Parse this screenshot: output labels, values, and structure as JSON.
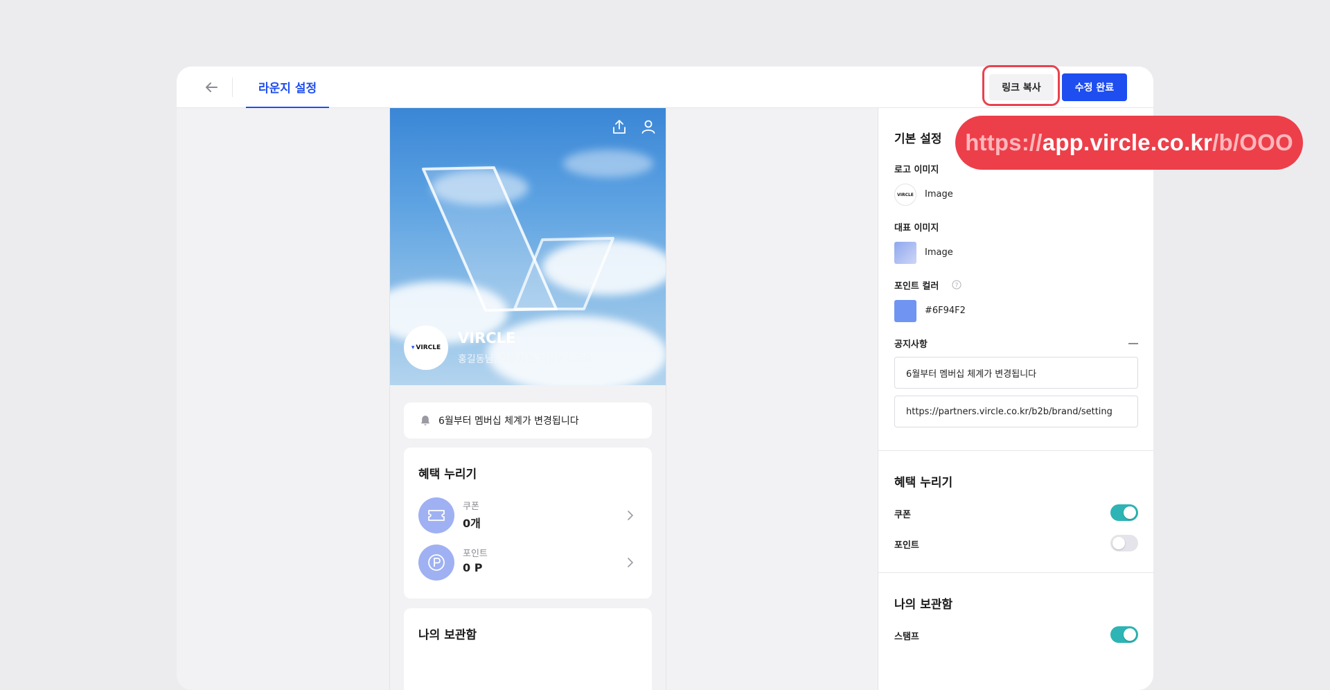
{
  "header": {
    "tab_label": "라운지 설정",
    "copy_link_label": "링크 복사",
    "done_label": "수정 완료"
  },
  "url_callout": {
    "protocol": "https://",
    "host": "app.vircle.co.kr",
    "path_prefix": "/b/",
    "slug": "OOO"
  },
  "preview": {
    "brand_name": "VIRCLE",
    "logo_text": "VIRCLE",
    "greeting": "홍길동님, 라운지는 처음이시군요",
    "notice_text": "6월부터 멤버십 체계가 변경됩니다",
    "benefits": {
      "title": "혜택 누리기",
      "coupon_label": "쿠폰",
      "coupon_value": "0개",
      "point_label": "포인트",
      "point_value": "0 P"
    },
    "vault_title": "나의 보관함"
  },
  "settings": {
    "basic_title": "기본 설정",
    "logo_image_label": "로고 이미지",
    "logo_image_value": "Image",
    "logo_thumb_text": "VIRCLE",
    "cover_image_label": "대표 이미지",
    "cover_image_value": "Image",
    "point_color_label": "포인트 컬러",
    "point_color_value": "#6F94F2",
    "notice_label": "공지사항",
    "notice_text": "6월부터 멤버십 체계가 변경됩니다",
    "notice_url": "https://partners.vircle.co.kr/b2b/brand/setting",
    "benefits_title": "혜택 누리기",
    "coupon_toggle_label": "쿠폰",
    "coupon_enabled": true,
    "point_toggle_label": "포인트",
    "point_enabled": false,
    "vault_title": "나의 보관함",
    "stamp_toggle_label": "스탬프",
    "stamp_enabled": true
  },
  "colors": {
    "accent": "#1E4DF0",
    "toggle_on": "#2EB4B4",
    "callout": "#EC3F4A",
    "point_color": "#6F94F2"
  }
}
